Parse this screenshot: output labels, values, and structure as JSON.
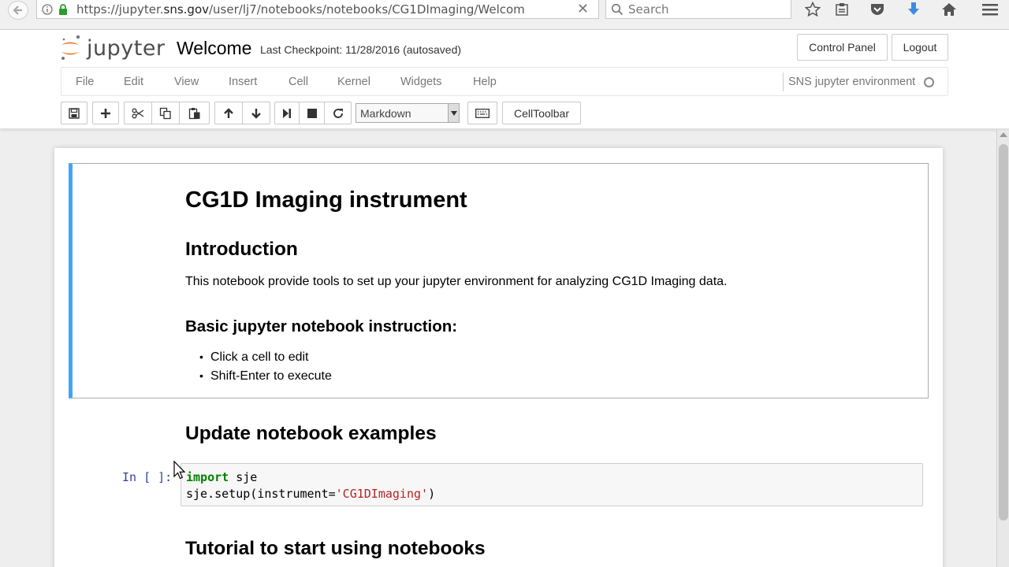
{
  "browser": {
    "url_prefix": "https://jupyter.",
    "url_host": "sns.gov",
    "url_path": "/user/lj7/notebooks/notebooks/CG1DImaging/Welcom",
    "search_placeholder": "Search",
    "icons": [
      "back-icon",
      "forward-icon",
      "info-icon",
      "lock-icon",
      "clear-icon",
      "search-icon",
      "bookmark-star-icon",
      "reading-list-icon",
      "pocket-icon",
      "download-icon",
      "home-icon",
      "menu-icon"
    ],
    "accent_color": "#3d8ae5"
  },
  "header": {
    "logo_text": "jupyter",
    "notebook_title": "Welcome",
    "checkpoint": "Last Checkpoint: 11/28/2016 (autosaved)",
    "control_panel_label": "Control Panel",
    "logout_label": "Logout"
  },
  "menubar": {
    "items": [
      "File",
      "Edit",
      "View",
      "Insert",
      "Cell",
      "Kernel",
      "Widgets",
      "Help"
    ],
    "kernel_name": "SNS jupyter environment"
  },
  "toolbar": {
    "buttons": [
      "save-icon",
      "add-cell-icon",
      "cut-icon",
      "copy-icon",
      "paste-icon",
      "move-up-icon",
      "move-down-icon",
      "run-icon",
      "stop-icon",
      "restart-icon",
      "keyboard-icon"
    ],
    "cell_type": "Markdown",
    "celltoolbar_label": "CellToolbar"
  },
  "notebook": {
    "md_title": "CG1D Imaging instrument",
    "intro_heading": "Introduction",
    "intro_text": "This notebook provide tools to set up your jupyter environment for analyzing CG1D Imaging data.",
    "basic_heading": "Basic jupyter notebook instruction:",
    "bullets": [
      "Click a cell to edit",
      "Shift-Enter to execute"
    ],
    "update_heading": "Update notebook examples",
    "code_prompt": "In [ ]:",
    "code": {
      "kw": "import",
      "line1_rest": " sje",
      "line2_pre": "sje.setup(instrument=",
      "line2_str": "'CG1DImaging'",
      "line2_post": ")"
    },
    "tutorial_heading": "Tutorial to start using notebooks",
    "selected_cell_color": "#42a5f5"
  }
}
